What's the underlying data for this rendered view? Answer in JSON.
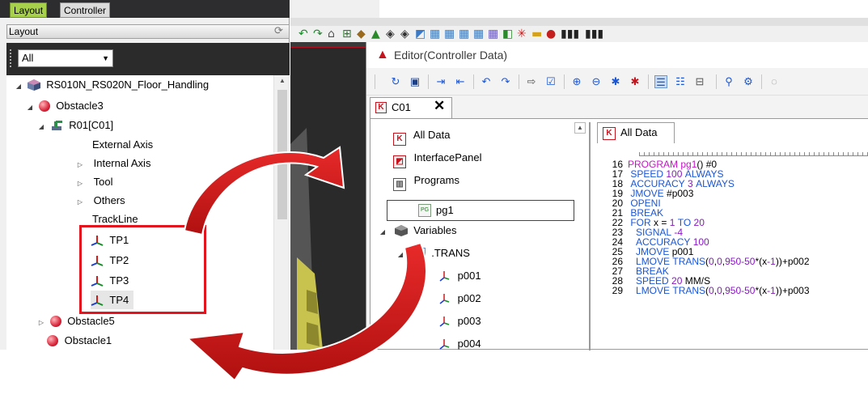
{
  "tabs": {
    "layout": "Layout",
    "controller": "Controller"
  },
  "layout_panel": {
    "header": "Layout",
    "filter_value": "All",
    "tree": [
      {
        "label": "RS010N_RS020N_Floor_Handling"
      },
      {
        "label": "Obstacle3"
      },
      {
        "label": "R01[C01]"
      },
      {
        "label": "External Axis"
      },
      {
        "label": "Internal Axis"
      },
      {
        "label": "Tool"
      },
      {
        "label": "Others"
      },
      {
        "label": "TrackLine"
      },
      {
        "label": "TP1"
      },
      {
        "label": "TP2"
      },
      {
        "label": "TP3"
      },
      {
        "label": "TP4"
      },
      {
        "label": "Obstacle5"
      },
      {
        "label": "Obstacle1"
      }
    ]
  },
  "editor": {
    "title": "Editor(Controller Data)",
    "doc_tab": "C01",
    "data_tree": [
      {
        "label": "All Data"
      },
      {
        "label": "InterfacePanel"
      },
      {
        "label": "Programs"
      },
      {
        "label": "pg1"
      },
      {
        "label": "Variables"
      },
      {
        "label": ".TRANS"
      },
      {
        "label": "p001"
      },
      {
        "label": "p002"
      },
      {
        "label": "p003"
      },
      {
        "label": "p004"
      }
    ],
    "code_tab": "All Data",
    "code": [
      {
        "n": "16",
        "a": "PROGRAM pg1() #0"
      },
      {
        "n": "17",
        "a": " SPEED 100 ALWAYS"
      },
      {
        "n": "18",
        "a": " ACCURACY 3 ALWAYS"
      },
      {
        "n": "19",
        "a": " JMOVE #p003"
      },
      {
        "n": "20",
        "a": " OPENI"
      },
      {
        "n": "21",
        "a": " BREAK"
      },
      {
        "n": "22",
        "a": " FOR x = 1 TO 20"
      },
      {
        "n": "23",
        "a": "   SIGNAL -4"
      },
      {
        "n": "24",
        "a": "   ACCURACY 100"
      },
      {
        "n": "25",
        "a": "   JMOVE p001"
      },
      {
        "n": "26",
        "a": "   LMOVE TRANS(0,0,950-50*(x-1))+p002"
      },
      {
        "n": "27",
        "a": "   BREAK"
      },
      {
        "n": "28",
        "a": "   SPEED 20 MM/S"
      },
      {
        "n": "29",
        "a": "   LMOVE TRANS(0,0,950-50*(x-1))+p003"
      }
    ]
  },
  "colors": {
    "highlight": "#e4141f",
    "keyword": "#1a56d6",
    "program": "#c516c5",
    "number": "#8a16c5",
    "tab_active": "#a8d14b"
  }
}
